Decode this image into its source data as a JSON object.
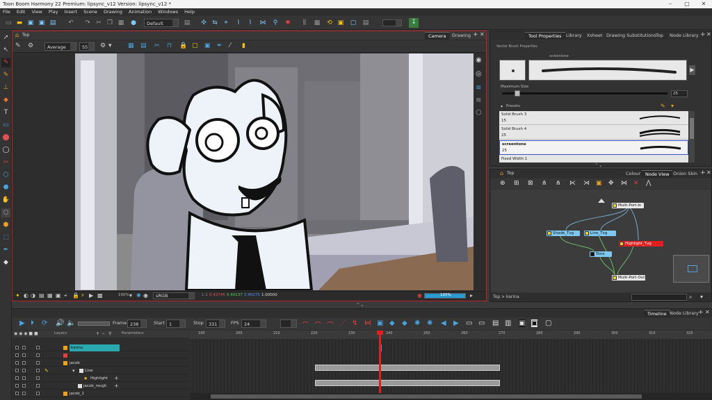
{
  "window": {
    "title": "Toon Boom Harmony 22 Premium: lipsync_v12 Version: lipsync_v12 *"
  },
  "menu": [
    "File",
    "Edit",
    "View",
    "Play",
    "Insert",
    "Scene",
    "Drawing",
    "Animation",
    "Windows",
    "Help"
  ],
  "toolbar": {
    "workspace": "Default"
  },
  "camera_view": {
    "breadcrumb": "Top",
    "tabs": [
      "Camera",
      "Drawing"
    ],
    "brush_mode": "Average",
    "brush_size": "55",
    "status": {
      "zoom": "100%",
      "colorspace": "sRGB",
      "coord_x": "0.42745",
      "coord_y": "0.40137",
      "coord_z": "0.46275",
      "alpha": "1.00000",
      "progress_label": "100%"
    }
  },
  "tool_properties": {
    "tabs": [
      "Tool Properties",
      "Library",
      "Xsheet",
      "Drawing Substitutions",
      "Top",
      "Node Library"
    ],
    "title": "Vector Brush Properties",
    "brush_name": "screentone",
    "maximum_size_label": "Maximum Size",
    "maximum_size_value": "25",
    "maximum_size_fraction": 0.08,
    "presets_label": "Presets",
    "presets": [
      {
        "name": "Solid Brush 3",
        "size": "15"
      },
      {
        "name": "Solid Brush 4",
        "size": "25"
      },
      {
        "name": "screentone",
        "size": "25",
        "selected": true
      },
      {
        "name": "Fixed Width 1",
        "size": ""
      }
    ]
  },
  "node_view": {
    "breadcrumb": "Top",
    "tabs": [
      "Colour",
      "Node View",
      "Onion Skin"
    ],
    "path": "Top  >  karina",
    "nodes": {
      "multi_port_in": "Multi-Port-In",
      "shade": "Shade_Tvg",
      "line": "Line_Tvg",
      "highlight": "Highlight_Tvg",
      "tone": "Tone",
      "multi_port_out": "Multi-Port-Out"
    }
  },
  "timeline": {
    "tabs": [
      "Timeline",
      "Node Library"
    ],
    "frame_label": "Frame",
    "frame": "238",
    "start_label": "Start",
    "start": "1",
    "stop_label": "Stop",
    "stop": "331",
    "fps_label": "FPS",
    "fps": "24",
    "layer_header": "Layers",
    "param_header": "Parameters",
    "layers": [
      "karina",
      "",
      "jacob",
      "Line",
      "Highlight",
      "jacob_rough",
      "jacob_1"
    ],
    "ruler": [
      "190",
      "200",
      "210",
      "220",
      "230",
      "240",
      "250",
      "260",
      "270",
      "280",
      "290",
      "300",
      "310",
      "320"
    ]
  },
  "colors": {
    "accent": "#4aa3df",
    "selection_red": "#b22222",
    "layer_teal": "#2aa8b0"
  }
}
